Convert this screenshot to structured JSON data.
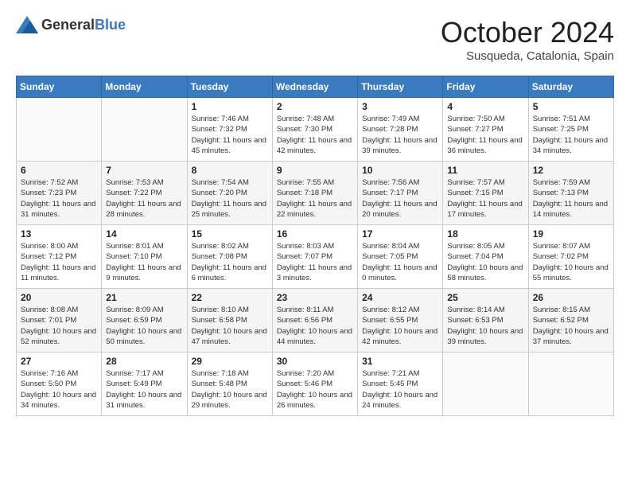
{
  "header": {
    "logo_general": "General",
    "logo_blue": "Blue",
    "month": "October 2024",
    "location": "Susqueda, Catalonia, Spain"
  },
  "days_of_week": [
    "Sunday",
    "Monday",
    "Tuesday",
    "Wednesday",
    "Thursday",
    "Friday",
    "Saturday"
  ],
  "weeks": [
    [
      {
        "day": "",
        "sunrise": "",
        "sunset": "",
        "daylight": ""
      },
      {
        "day": "",
        "sunrise": "",
        "sunset": "",
        "daylight": ""
      },
      {
        "day": "1",
        "sunrise": "Sunrise: 7:46 AM",
        "sunset": "Sunset: 7:32 PM",
        "daylight": "Daylight: 11 hours and 45 minutes."
      },
      {
        "day": "2",
        "sunrise": "Sunrise: 7:48 AM",
        "sunset": "Sunset: 7:30 PM",
        "daylight": "Daylight: 11 hours and 42 minutes."
      },
      {
        "day": "3",
        "sunrise": "Sunrise: 7:49 AM",
        "sunset": "Sunset: 7:28 PM",
        "daylight": "Daylight: 11 hours and 39 minutes."
      },
      {
        "day": "4",
        "sunrise": "Sunrise: 7:50 AM",
        "sunset": "Sunset: 7:27 PM",
        "daylight": "Daylight: 11 hours and 36 minutes."
      },
      {
        "day": "5",
        "sunrise": "Sunrise: 7:51 AM",
        "sunset": "Sunset: 7:25 PM",
        "daylight": "Daylight: 11 hours and 34 minutes."
      }
    ],
    [
      {
        "day": "6",
        "sunrise": "Sunrise: 7:52 AM",
        "sunset": "Sunset: 7:23 PM",
        "daylight": "Daylight: 11 hours and 31 minutes."
      },
      {
        "day": "7",
        "sunrise": "Sunrise: 7:53 AM",
        "sunset": "Sunset: 7:22 PM",
        "daylight": "Daylight: 11 hours and 28 minutes."
      },
      {
        "day": "8",
        "sunrise": "Sunrise: 7:54 AM",
        "sunset": "Sunset: 7:20 PM",
        "daylight": "Daylight: 11 hours and 25 minutes."
      },
      {
        "day": "9",
        "sunrise": "Sunrise: 7:55 AM",
        "sunset": "Sunset: 7:18 PM",
        "daylight": "Daylight: 11 hours and 22 minutes."
      },
      {
        "day": "10",
        "sunrise": "Sunrise: 7:56 AM",
        "sunset": "Sunset: 7:17 PM",
        "daylight": "Daylight: 11 hours and 20 minutes."
      },
      {
        "day": "11",
        "sunrise": "Sunrise: 7:57 AM",
        "sunset": "Sunset: 7:15 PM",
        "daylight": "Daylight: 11 hours and 17 minutes."
      },
      {
        "day": "12",
        "sunrise": "Sunrise: 7:59 AM",
        "sunset": "Sunset: 7:13 PM",
        "daylight": "Daylight: 11 hours and 14 minutes."
      }
    ],
    [
      {
        "day": "13",
        "sunrise": "Sunrise: 8:00 AM",
        "sunset": "Sunset: 7:12 PM",
        "daylight": "Daylight: 11 hours and 11 minutes."
      },
      {
        "day": "14",
        "sunrise": "Sunrise: 8:01 AM",
        "sunset": "Sunset: 7:10 PM",
        "daylight": "Daylight: 11 hours and 9 minutes."
      },
      {
        "day": "15",
        "sunrise": "Sunrise: 8:02 AM",
        "sunset": "Sunset: 7:08 PM",
        "daylight": "Daylight: 11 hours and 6 minutes."
      },
      {
        "day": "16",
        "sunrise": "Sunrise: 8:03 AM",
        "sunset": "Sunset: 7:07 PM",
        "daylight": "Daylight: 11 hours and 3 minutes."
      },
      {
        "day": "17",
        "sunrise": "Sunrise: 8:04 AM",
        "sunset": "Sunset: 7:05 PM",
        "daylight": "Daylight: 11 hours and 0 minutes."
      },
      {
        "day": "18",
        "sunrise": "Sunrise: 8:05 AM",
        "sunset": "Sunset: 7:04 PM",
        "daylight": "Daylight: 10 hours and 58 minutes."
      },
      {
        "day": "19",
        "sunrise": "Sunrise: 8:07 AM",
        "sunset": "Sunset: 7:02 PM",
        "daylight": "Daylight: 10 hours and 55 minutes."
      }
    ],
    [
      {
        "day": "20",
        "sunrise": "Sunrise: 8:08 AM",
        "sunset": "Sunset: 7:01 PM",
        "daylight": "Daylight: 10 hours and 52 minutes."
      },
      {
        "day": "21",
        "sunrise": "Sunrise: 8:09 AM",
        "sunset": "Sunset: 6:59 PM",
        "daylight": "Daylight: 10 hours and 50 minutes."
      },
      {
        "day": "22",
        "sunrise": "Sunrise: 8:10 AM",
        "sunset": "Sunset: 6:58 PM",
        "daylight": "Daylight: 10 hours and 47 minutes."
      },
      {
        "day": "23",
        "sunrise": "Sunrise: 8:11 AM",
        "sunset": "Sunset: 6:56 PM",
        "daylight": "Daylight: 10 hours and 44 minutes."
      },
      {
        "day": "24",
        "sunrise": "Sunrise: 8:12 AM",
        "sunset": "Sunset: 6:55 PM",
        "daylight": "Daylight: 10 hours and 42 minutes."
      },
      {
        "day": "25",
        "sunrise": "Sunrise: 8:14 AM",
        "sunset": "Sunset: 6:53 PM",
        "daylight": "Daylight: 10 hours and 39 minutes."
      },
      {
        "day": "26",
        "sunrise": "Sunrise: 8:15 AM",
        "sunset": "Sunset: 6:52 PM",
        "daylight": "Daylight: 10 hours and 37 minutes."
      }
    ],
    [
      {
        "day": "27",
        "sunrise": "Sunrise: 7:16 AM",
        "sunset": "Sunset: 5:50 PM",
        "daylight": "Daylight: 10 hours and 34 minutes."
      },
      {
        "day": "28",
        "sunrise": "Sunrise: 7:17 AM",
        "sunset": "Sunset: 5:49 PM",
        "daylight": "Daylight: 10 hours and 31 minutes."
      },
      {
        "day": "29",
        "sunrise": "Sunrise: 7:18 AM",
        "sunset": "Sunset: 5:48 PM",
        "daylight": "Daylight: 10 hours and 29 minutes."
      },
      {
        "day": "30",
        "sunrise": "Sunrise: 7:20 AM",
        "sunset": "Sunset: 5:46 PM",
        "daylight": "Daylight: 10 hours and 26 minutes."
      },
      {
        "day": "31",
        "sunrise": "Sunrise: 7:21 AM",
        "sunset": "Sunset: 5:45 PM",
        "daylight": "Daylight: 10 hours and 24 minutes."
      },
      {
        "day": "",
        "sunrise": "",
        "sunset": "",
        "daylight": ""
      },
      {
        "day": "",
        "sunrise": "",
        "sunset": "",
        "daylight": ""
      }
    ]
  ]
}
